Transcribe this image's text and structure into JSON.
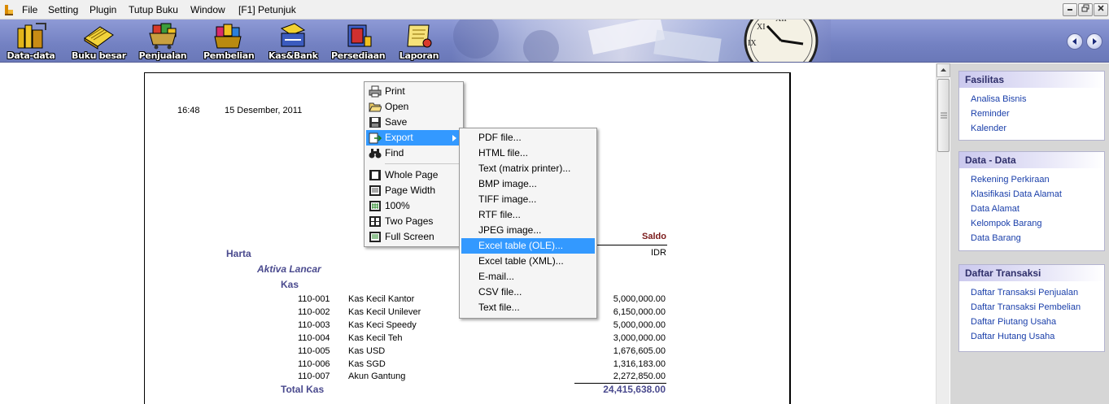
{
  "menubar": {
    "items": [
      "File",
      "Setting",
      "Plugin",
      "Tutup Buku",
      "Window",
      "[F1] Petunjuk"
    ]
  },
  "toolbar": {
    "buttons": [
      "Data-data",
      "Buku besar",
      "Penjualan",
      "Pembelian",
      "Kas&Bank",
      "Persediaan",
      "Laporan"
    ]
  },
  "report": {
    "time": "16:48",
    "date": "15 Desember, 2011",
    "saldo_header": "Saldo",
    "currency": "IDR",
    "section": "Harta",
    "subsection": "Aktiva Lancar",
    "group": "Kas",
    "rows": [
      {
        "code": "110-001",
        "name": "Kas Kecil Kantor",
        "amount": "5,000,000.00"
      },
      {
        "code": "110-002",
        "name": "Kas Kecil Unilever",
        "amount": "6,150,000.00"
      },
      {
        "code": "110-003",
        "name": "Kas Keci Speedy",
        "amount": "5,000,000.00"
      },
      {
        "code": "110-004",
        "name": "Kas Kecil Teh",
        "amount": "3,000,000.00"
      },
      {
        "code": "110-005",
        "name": "Kas USD",
        "amount": "1,676,605.00"
      },
      {
        "code": "110-006",
        "name": "Kas SGD",
        "amount": "1,316,183.00"
      },
      {
        "code": "110-007",
        "name": "Akun Gantung",
        "amount": "2,272,850.00"
      }
    ],
    "total_label": "Total Kas",
    "total_amount": "24,415,638.00"
  },
  "context_menu": {
    "items": [
      "Print",
      "Open",
      "Save",
      "Export",
      "Find",
      "Whole Page",
      "Page Width",
      "100%",
      "Two Pages",
      "Full Screen"
    ],
    "selected": "Export"
  },
  "export_menu": {
    "items": [
      "PDF file...",
      "HTML file...",
      "Text (matrix printer)...",
      "BMP image...",
      "TIFF image...",
      "RTF file...",
      "JPEG image...",
      "Excel table (OLE)...",
      "Excel table (XML)...",
      "E-mail...",
      "CSV file...",
      "Text file..."
    ],
    "selected": "Excel table (OLE)..."
  },
  "side_panel": {
    "fasilitas": {
      "title": "Fasilitas",
      "links": [
        "Analisa Bisnis",
        "Reminder",
        "Kalender"
      ]
    },
    "data_data": {
      "title": "Data - Data",
      "links": [
        "Rekening Perkiraan",
        "Klasifikasi Data Alamat",
        "Data Alamat",
        "Kelompok Barang",
        "Data Barang"
      ]
    },
    "daftar_transaksi": {
      "title": "Daftar Transaksi",
      "links": [
        "Daftar Transaksi Penjualan",
        "Daftar Transaksi Pembelian",
        "Daftar Piutang Usaha",
        "Daftar Hutang Usaha"
      ]
    }
  },
  "colors": {
    "toolbar_bg": "#7381c2",
    "menu_highlight": "#3399ff",
    "saldo_header": "#7a1a1a",
    "report_heading": "#4a4a8e",
    "link": "#1a3faa"
  }
}
